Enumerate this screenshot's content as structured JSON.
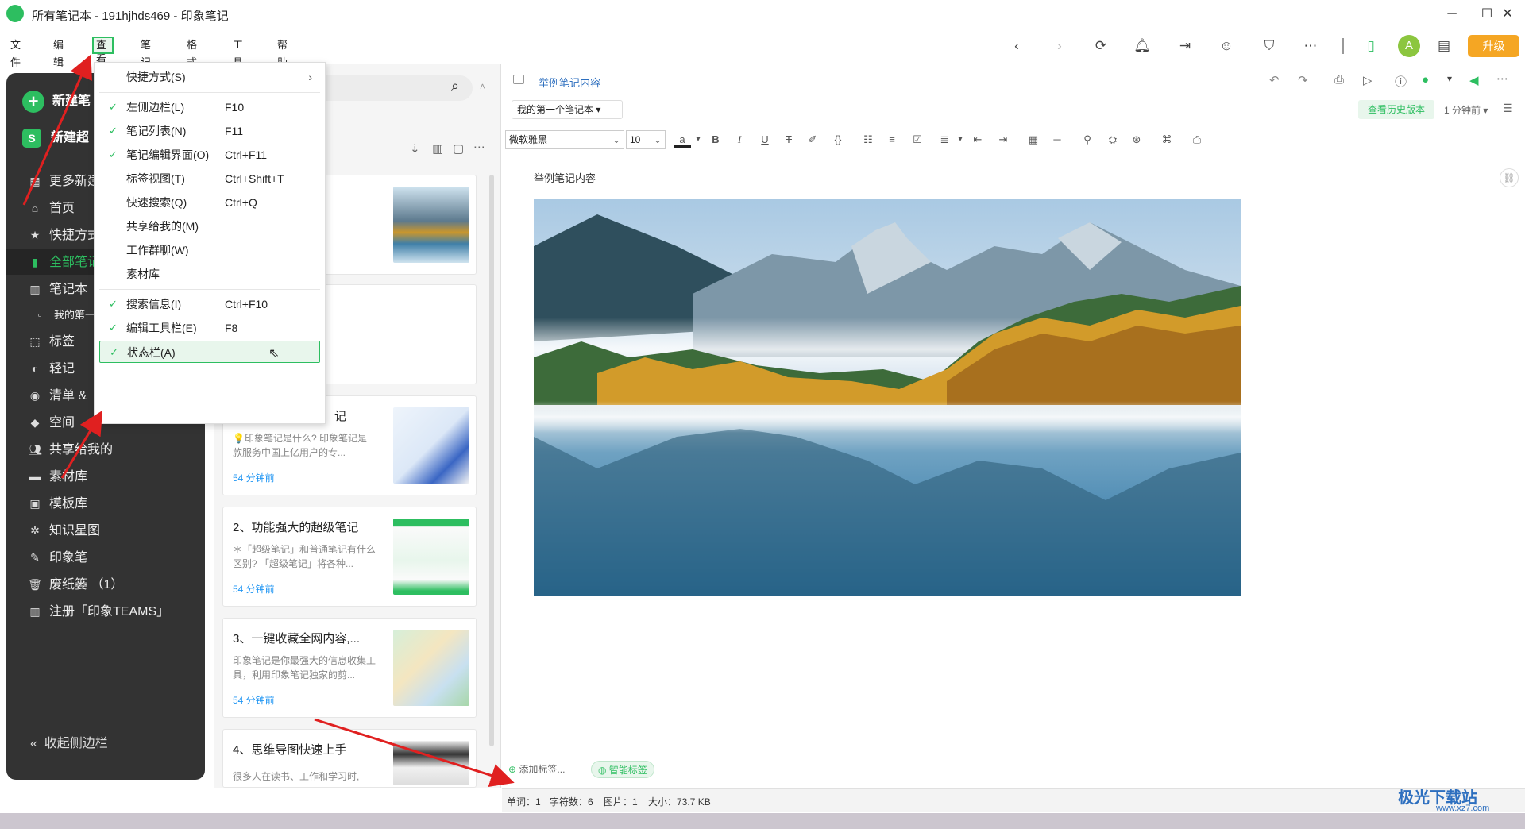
{
  "window": {
    "title": "所有笔记本 - 191hjhds469 - 印象笔记",
    "minimize": "─",
    "maximize": "☐",
    "close": "✕"
  },
  "menu": [
    "文件(F)",
    "编辑(E)",
    "查看(V)",
    "笔记(N)",
    "格式(O)",
    "工具(T)",
    "帮助(H)"
  ],
  "toolbar": {
    "avatar": "A",
    "upgrade": "升级"
  },
  "sidebar": {
    "new_note": "新建笔",
    "new_super": "新建超",
    "items": [
      "更多新建",
      "首页",
      "快捷方式",
      "全部笔记",
      "笔记本",
      "我的第一",
      "标签",
      "轻记",
      "清单 &",
      "空间",
      "共享给我的",
      "素材库",
      "模板库",
      "知识星图",
      "印象笔",
      "废纸篓 （1）",
      "注册「印象TEAMS」"
    ],
    "collapse": "收起侧边栏"
  },
  "dropdown": [
    {
      "label": "快捷方式(S)",
      "shortcut": "",
      "checked": false,
      "arrow": "›"
    },
    {
      "label": "左侧边栏(L)",
      "shortcut": "F10",
      "checked": true
    },
    {
      "label": "笔记列表(N)",
      "shortcut": "F11",
      "checked": true
    },
    {
      "label": "笔记编辑界面(O)",
      "shortcut": "Ctrl+F11",
      "checked": true
    },
    {
      "label": "标签视图(T)",
      "shortcut": "Ctrl+Shift+T",
      "checked": false
    },
    {
      "label": "快速搜索(Q)",
      "shortcut": "Ctrl+Q",
      "checked": false
    },
    {
      "label": "共享给我的(M)",
      "shortcut": "",
      "checked": false
    },
    {
      "label": "工作群聊(W)",
      "shortcut": "",
      "checked": false
    },
    {
      "label": "素材库",
      "shortcut": "",
      "checked": false
    },
    {
      "label": "搜索信息(I)",
      "shortcut": "Ctrl+F10",
      "checked": true
    },
    {
      "label": "编辑工具栏(E)",
      "shortcut": "F8",
      "checked": true
    },
    {
      "label": "状态栏(A)",
      "shortcut": "",
      "checked": true
    }
  ],
  "cards": [
    {
      "title": "",
      "snippet": "",
      "time": ""
    },
    {
      "title": "",
      "snippet": "",
      "time": ""
    },
    {
      "title": "记",
      "snippet": "💡印象笔记是什么? 印象笔记是一款服务中国上亿用户的专...",
      "time": "54 分钟前"
    },
    {
      "title": "2、功能强大的超级笔记",
      "snippet": "＊「超级笔记」和普通笔记有什么区别? 「超级笔记」将各种...",
      "time": "54 分钟前"
    },
    {
      "title": "3、一键收藏全网内容,...",
      "snippet": "印象笔记是你最强大的信息收集工具，利用印象笔记独家的剪...",
      "time": "54 分钟前"
    },
    {
      "title": "4、思维导图快速上手",
      "snippet": "很多人在读书、工作和学习时,",
      "time": ""
    }
  ],
  "editor": {
    "breadcrumb": "举例笔记内容",
    "notebook": "我的第一个笔记本 ▾",
    "history": "查看历史版本",
    "time_ago": "1 分钟前 ▾",
    "font": "微软雅黑",
    "font_size": "10",
    "note_title": "举例笔记内容",
    "add_tag": "添加标签...",
    "smart_tag": "智能标签"
  },
  "status": {
    "words": "单词：1",
    "chars": "字符数：6",
    "images": "图片：1",
    "size": "大小：73.7 KB"
  },
  "watermark": {
    "brand": "极光下载站",
    "url": "www.xz7.com"
  }
}
